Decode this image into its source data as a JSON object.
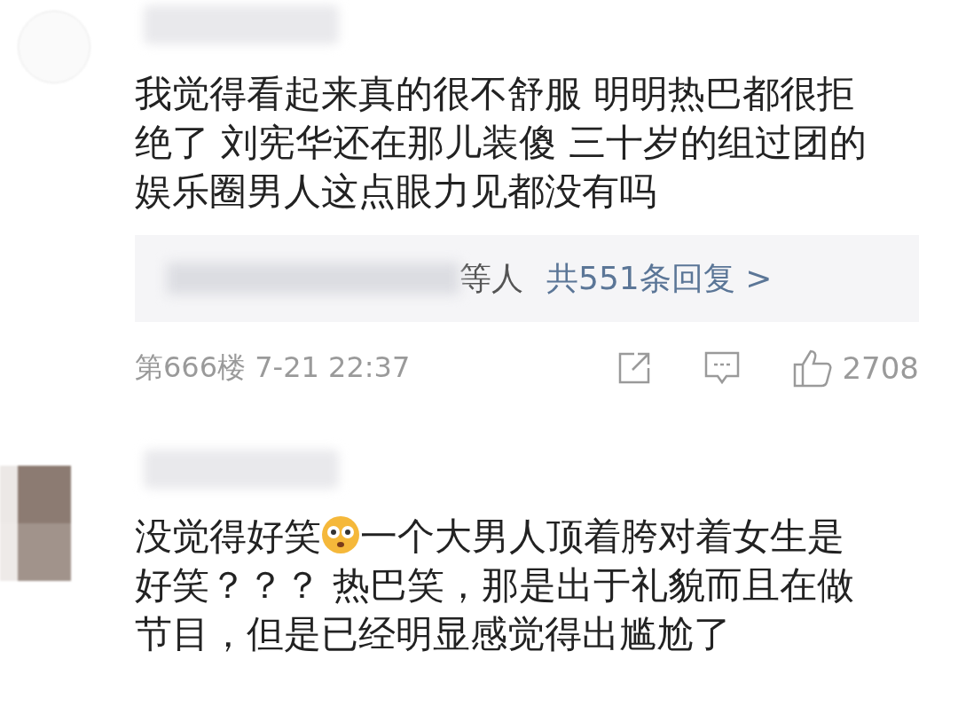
{
  "comments": [
    {
      "segments": [
        {
          "kind": "text",
          "text": "我觉得看起来真的很不舒服 明明热巴都很拒"
        },
        {
          "kind": "break"
        },
        {
          "kind": "text",
          "text": "绝了 刘宪华还在那儿装傻 三十岁的组过团的"
        },
        {
          "kind": "break"
        },
        {
          "kind": "text",
          "text": "娱乐圈男人这点眼力见都没有吗"
        }
      ],
      "replies": {
        "names_suffix": "等人",
        "link": "共551条回复 >"
      },
      "footer": {
        "floor_time": "第666楼 7-21 22:37",
        "likes": "2708"
      }
    },
    {
      "segments": [
        {
          "kind": "text",
          "text": "没觉得好笑"
        },
        {
          "kind": "emoji"
        },
        {
          "kind": "text",
          "text": "一个大男人顶着胯对着女生是"
        },
        {
          "kind": "break"
        },
        {
          "kind": "text",
          "text": "好笑？？？ 热巴笑，那是出于礼貌而且在做"
        },
        {
          "kind": "break"
        },
        {
          "kind": "text",
          "text": "节目，但是已经明显感觉得出尴尬了"
        }
      ]
    }
  ]
}
